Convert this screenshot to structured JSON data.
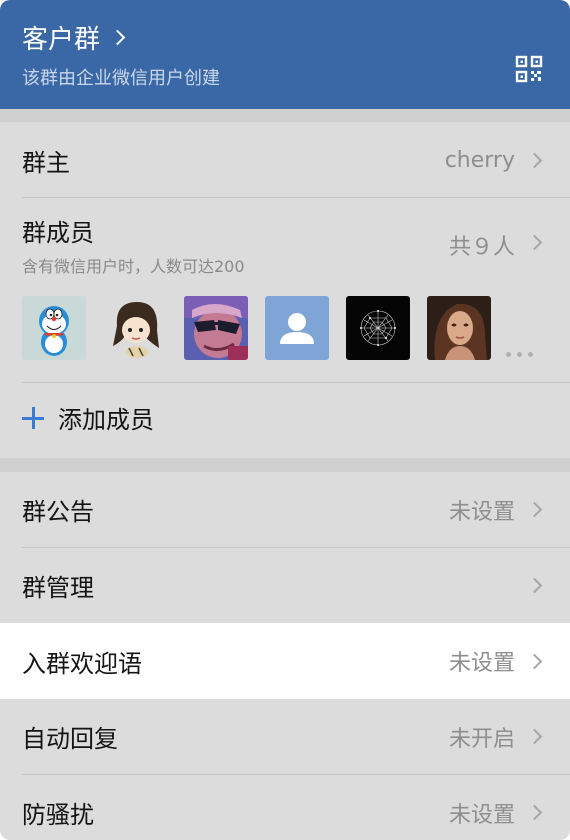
{
  "header": {
    "title": "客户群",
    "subtitle": "该群由企业微信用户创建",
    "qr_icon": "qr-code-icon"
  },
  "owner": {
    "label": "群主",
    "value": "cherry"
  },
  "members": {
    "label": "群成员",
    "count": "共９人",
    "note": "含有微信用户时，人数可达200",
    "avatars": [
      "doraemon",
      "cartoon-girl",
      "sunglasses-man",
      "default-person",
      "dark-network",
      "woman-portrait"
    ]
  },
  "add_member": {
    "label": "添加成员"
  },
  "settings": [
    {
      "label": "群公告",
      "value": "未设置"
    },
    {
      "label": "群管理",
      "value": ""
    },
    {
      "label": "入群欢迎语",
      "value": "未设置"
    },
    {
      "label": "自动回复",
      "value": "未开启"
    },
    {
      "label": "防骚扰",
      "value": "未设置"
    }
  ],
  "colors": {
    "header_bg": "#3a68a6",
    "accent": "#3a7bd5",
    "page_bg": "#dcdcdc"
  }
}
